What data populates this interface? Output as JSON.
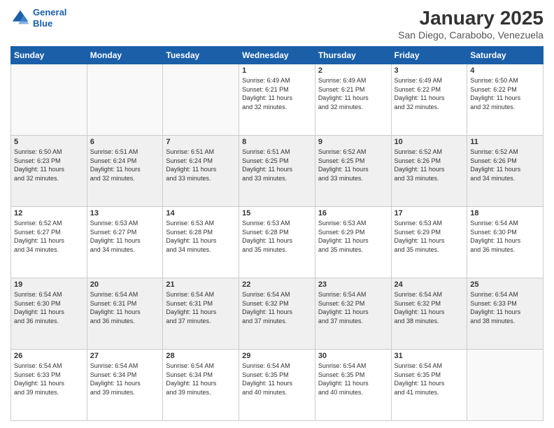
{
  "header": {
    "logo_line1": "General",
    "logo_line2": "Blue",
    "title": "January 2025",
    "subtitle": "San Diego, Carabobo, Venezuela"
  },
  "weekdays": [
    "Sunday",
    "Monday",
    "Tuesday",
    "Wednesday",
    "Thursday",
    "Friday",
    "Saturday"
  ],
  "weeks": [
    [
      {
        "day": "",
        "info": ""
      },
      {
        "day": "",
        "info": ""
      },
      {
        "day": "",
        "info": ""
      },
      {
        "day": "1",
        "info": "Sunrise: 6:49 AM\nSunset: 6:21 PM\nDaylight: 11 hours\nand 32 minutes."
      },
      {
        "day": "2",
        "info": "Sunrise: 6:49 AM\nSunset: 6:21 PM\nDaylight: 11 hours\nand 32 minutes."
      },
      {
        "day": "3",
        "info": "Sunrise: 6:49 AM\nSunset: 6:22 PM\nDaylight: 11 hours\nand 32 minutes."
      },
      {
        "day": "4",
        "info": "Sunrise: 6:50 AM\nSunset: 6:22 PM\nDaylight: 11 hours\nand 32 minutes."
      }
    ],
    [
      {
        "day": "5",
        "info": "Sunrise: 6:50 AM\nSunset: 6:23 PM\nDaylight: 11 hours\nand 32 minutes."
      },
      {
        "day": "6",
        "info": "Sunrise: 6:51 AM\nSunset: 6:24 PM\nDaylight: 11 hours\nand 32 minutes."
      },
      {
        "day": "7",
        "info": "Sunrise: 6:51 AM\nSunset: 6:24 PM\nDaylight: 11 hours\nand 33 minutes."
      },
      {
        "day": "8",
        "info": "Sunrise: 6:51 AM\nSunset: 6:25 PM\nDaylight: 11 hours\nand 33 minutes."
      },
      {
        "day": "9",
        "info": "Sunrise: 6:52 AM\nSunset: 6:25 PM\nDaylight: 11 hours\nand 33 minutes."
      },
      {
        "day": "10",
        "info": "Sunrise: 6:52 AM\nSunset: 6:26 PM\nDaylight: 11 hours\nand 33 minutes."
      },
      {
        "day": "11",
        "info": "Sunrise: 6:52 AM\nSunset: 6:26 PM\nDaylight: 11 hours\nand 34 minutes."
      }
    ],
    [
      {
        "day": "12",
        "info": "Sunrise: 6:52 AM\nSunset: 6:27 PM\nDaylight: 11 hours\nand 34 minutes."
      },
      {
        "day": "13",
        "info": "Sunrise: 6:53 AM\nSunset: 6:27 PM\nDaylight: 11 hours\nand 34 minutes."
      },
      {
        "day": "14",
        "info": "Sunrise: 6:53 AM\nSunset: 6:28 PM\nDaylight: 11 hours\nand 34 minutes."
      },
      {
        "day": "15",
        "info": "Sunrise: 6:53 AM\nSunset: 6:28 PM\nDaylight: 11 hours\nand 35 minutes."
      },
      {
        "day": "16",
        "info": "Sunrise: 6:53 AM\nSunset: 6:29 PM\nDaylight: 11 hours\nand 35 minutes."
      },
      {
        "day": "17",
        "info": "Sunrise: 6:53 AM\nSunset: 6:29 PM\nDaylight: 11 hours\nand 35 minutes."
      },
      {
        "day": "18",
        "info": "Sunrise: 6:54 AM\nSunset: 6:30 PM\nDaylight: 11 hours\nand 36 minutes."
      }
    ],
    [
      {
        "day": "19",
        "info": "Sunrise: 6:54 AM\nSunset: 6:30 PM\nDaylight: 11 hours\nand 36 minutes."
      },
      {
        "day": "20",
        "info": "Sunrise: 6:54 AM\nSunset: 6:31 PM\nDaylight: 11 hours\nand 36 minutes."
      },
      {
        "day": "21",
        "info": "Sunrise: 6:54 AM\nSunset: 6:31 PM\nDaylight: 11 hours\nand 37 minutes."
      },
      {
        "day": "22",
        "info": "Sunrise: 6:54 AM\nSunset: 6:32 PM\nDaylight: 11 hours\nand 37 minutes."
      },
      {
        "day": "23",
        "info": "Sunrise: 6:54 AM\nSunset: 6:32 PM\nDaylight: 11 hours\nand 37 minutes."
      },
      {
        "day": "24",
        "info": "Sunrise: 6:54 AM\nSunset: 6:32 PM\nDaylight: 11 hours\nand 38 minutes."
      },
      {
        "day": "25",
        "info": "Sunrise: 6:54 AM\nSunset: 6:33 PM\nDaylight: 11 hours\nand 38 minutes."
      }
    ],
    [
      {
        "day": "26",
        "info": "Sunrise: 6:54 AM\nSunset: 6:33 PM\nDaylight: 11 hours\nand 39 minutes."
      },
      {
        "day": "27",
        "info": "Sunrise: 6:54 AM\nSunset: 6:34 PM\nDaylight: 11 hours\nand 39 minutes."
      },
      {
        "day": "28",
        "info": "Sunrise: 6:54 AM\nSunset: 6:34 PM\nDaylight: 11 hours\nand 39 minutes."
      },
      {
        "day": "29",
        "info": "Sunrise: 6:54 AM\nSunset: 6:35 PM\nDaylight: 11 hours\nand 40 minutes."
      },
      {
        "day": "30",
        "info": "Sunrise: 6:54 AM\nSunset: 6:35 PM\nDaylight: 11 hours\nand 40 minutes."
      },
      {
        "day": "31",
        "info": "Sunrise: 6:54 AM\nSunset: 6:35 PM\nDaylight: 11 hours\nand 41 minutes."
      },
      {
        "day": "",
        "info": ""
      }
    ]
  ]
}
